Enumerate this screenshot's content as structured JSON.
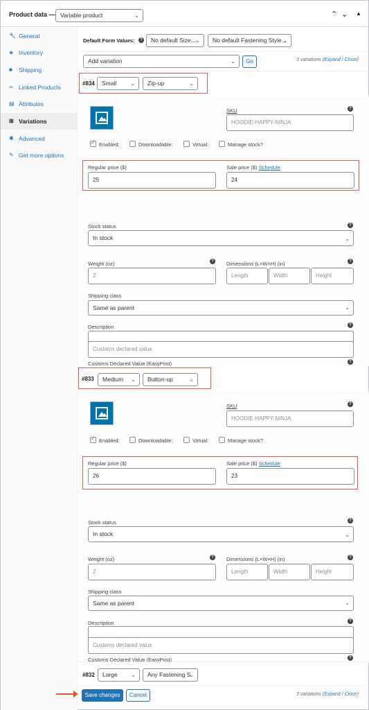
{
  "header": {
    "title": "Product data —",
    "product_type": "Variable product",
    "icons": [
      "chevron-up-icon",
      "chevron-down-icon",
      "caret-toggle-icon"
    ]
  },
  "sidebar": {
    "items": [
      {
        "label": "General",
        "icon": "wrench-icon"
      },
      {
        "label": "Inventory",
        "icon": "tag-icon"
      },
      {
        "label": "Shipping",
        "icon": "truck-icon"
      },
      {
        "label": "Linked Products",
        "icon": "link-icon"
      },
      {
        "label": "Attributes",
        "icon": "list-icon"
      },
      {
        "label": "Variations",
        "icon": "grid-icon",
        "active": true
      },
      {
        "label": "Advanced",
        "icon": "gear-icon"
      },
      {
        "label": "Get more options",
        "icon": "plugin-icon"
      }
    ]
  },
  "defaults": {
    "label": "Default Form Values:",
    "size": "No default Size...",
    "fastening": "No default Fastening Style..."
  },
  "toolbar": {
    "add_variation": "Add variation",
    "go": "Go",
    "count_text": "3 variations (",
    "expand": "Expand",
    "sep": " / ",
    "close": "Close",
    "count_end": ")"
  },
  "variations": [
    {
      "id": "#834",
      "size": "Small",
      "style": "Zip-up",
      "sku_label": "SKU",
      "sku_placeholder": "HOODIE-HAPPY-NINJA",
      "enabled_label": "Enabled:",
      "downloadable_label": "Downloadable:",
      "virtual_label": "Virtual:",
      "manage_stock_label": "Manage stock?",
      "regular_price_label": "Regular price ($)",
      "regular_price": "25",
      "sale_price_label": "Sale price ($)",
      "schedule": "Schedule",
      "sale_price": "24",
      "stock_status_label": "Stock status",
      "stock_status": "In stock",
      "weight_label": "Weight (oz)",
      "weight_placeholder": "2",
      "dimensions_label": "Dimensions (L×W×H) (in)",
      "length": "Length",
      "width": "Width",
      "height": "Height",
      "shipping_class_label": "Shipping class",
      "shipping_class": "Same as parent",
      "description_label": "Description",
      "customs_label": "Customs Declared Value (EasyPost)",
      "customs_placeholder": "Customs declared value"
    },
    {
      "id": "#833",
      "size": "Medium",
      "style": "Button-up",
      "sku_label": "SKU",
      "sku_placeholder": "HOODIE-HAPPY-NINJA",
      "enabled_label": "Enabled:",
      "downloadable_label": "Downloadable:",
      "virtual_label": "Virtual:",
      "manage_stock_label": "Manage stock?",
      "regular_price_label": "Regular price ($)",
      "regular_price": "26",
      "sale_price_label": "Sale price ($)",
      "schedule": "Schedule",
      "sale_price": "23",
      "stock_status_label": "Stock status",
      "stock_status": "In stock",
      "weight_label": "Weight (oz)",
      "weight_placeholder": "2",
      "dimensions_label": "Dimensions (L×W×H) (in)",
      "length": "Length",
      "width": "Width",
      "height": "Height",
      "shipping_class_label": "Shipping class",
      "shipping_class": "Same as parent",
      "description_label": "Description",
      "customs_label": "Customs Declared Value (EasyPost)",
      "customs_placeholder": "Customs declared value"
    },
    {
      "id": "#832",
      "size": "Large",
      "style": "Any Fastening S"
    }
  ],
  "footer": {
    "save": "Save changes",
    "cancel": "Cancel",
    "count_text": "3 variations (",
    "expand": "Expand",
    "sep": " / ",
    "close": "Close",
    "count_end": ")"
  },
  "colors": {
    "accent": "#2271b1",
    "highlight": "#e2575a",
    "arrow": "#e2572b"
  }
}
